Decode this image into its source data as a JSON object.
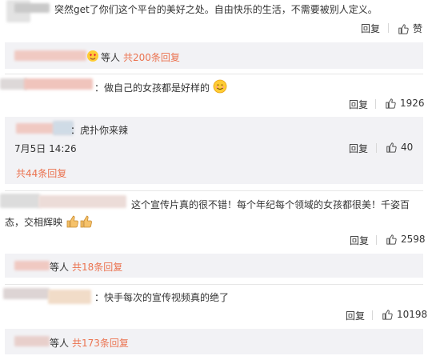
{
  "comments": [
    {
      "text": "突然get了你们这个平台的美好之处。自由快乐的生活，不需要被别人定义。",
      "reply_label": "回复",
      "like_label": "赞",
      "summary": {
        "prefix": "等人",
        "link": "共200条回复"
      }
    },
    {
      "text": "：做自己的女孩都是好样的",
      "emoji": "smile-emoji",
      "reply_label": "回复",
      "likes": "1926",
      "sub_reply": {
        "text": "：虎扑你来辣",
        "time": "7月5日 14:26",
        "reply_label": "回复",
        "likes": "40"
      },
      "summary_link": "共44条回复"
    },
    {
      "text_line1": "这个宣传片真的很不错！每个年纪每个领域的女孩都很美！千姿百",
      "text_line2": "态，交相辉映",
      "emoji": "thumbs-up-emoji",
      "reply_label": "回复",
      "likes": "2598",
      "summary": {
        "prefix": "等人",
        "link": "共18条回复"
      }
    },
    {
      "text": "：快手每次的宣传视频真的绝了",
      "reply_label": "回复",
      "likes": "10198",
      "summary": {
        "prefix": "等人",
        "link": "共173条回复"
      }
    }
  ],
  "colors": {
    "accent": "#eb7350",
    "subbox": "#f2f2f5",
    "text": "#333333"
  }
}
